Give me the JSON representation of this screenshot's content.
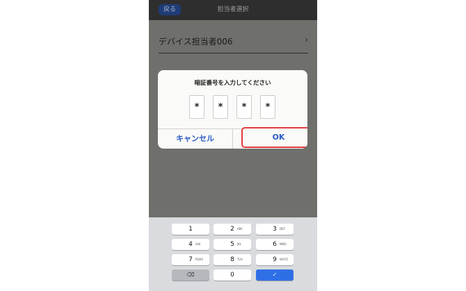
{
  "header": {
    "back_label": "戻る",
    "title": "担当者選択"
  },
  "list": {
    "item_label": "デバイス担当者006",
    "item_chevron": "›"
  },
  "dialog": {
    "title": "暗証番号を入力してください",
    "pin": [
      "*",
      "*",
      "*",
      "*"
    ],
    "cancel_label": "キャンセル",
    "ok_label": "OK",
    "ok_highlight_color": "#e23b3b"
  },
  "keypad": {
    "keys": [
      {
        "num": "1",
        "sub": ""
      },
      {
        "num": "2",
        "sub": "ABC"
      },
      {
        "num": "3",
        "sub": "DEF"
      },
      {
        "num": "4",
        "sub": "GHI"
      },
      {
        "num": "5",
        "sub": "JKL"
      },
      {
        "num": "6",
        "sub": "MNO"
      },
      {
        "num": "7",
        "sub": "PQRS"
      },
      {
        "num": "8",
        "sub": "TUV"
      },
      {
        "num": "9",
        "sub": "WXYZ"
      },
      {
        "num": "0",
        "sub": ""
      }
    ],
    "delete_icon": "⌫",
    "done_icon": "✓"
  }
}
